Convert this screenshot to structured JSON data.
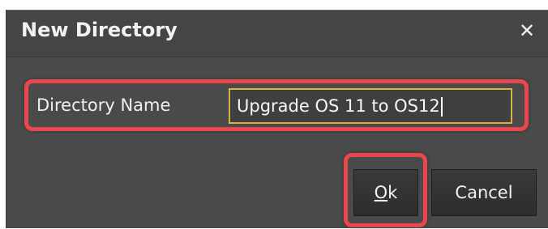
{
  "dialog": {
    "title": "New Directory",
    "close_icon": "close-icon",
    "field": {
      "label": "Directory Name",
      "value": "Upgrade OS 11 to OS12"
    },
    "buttons": {
      "ok_mnemonic": "O",
      "ok_rest": "k",
      "cancel_label": "Cancel"
    }
  },
  "colors": {
    "dialog_bg": "#4a4a4a",
    "highlight": "#e8474c",
    "input_border": "#d7b342",
    "text": "#f2f2f2"
  }
}
